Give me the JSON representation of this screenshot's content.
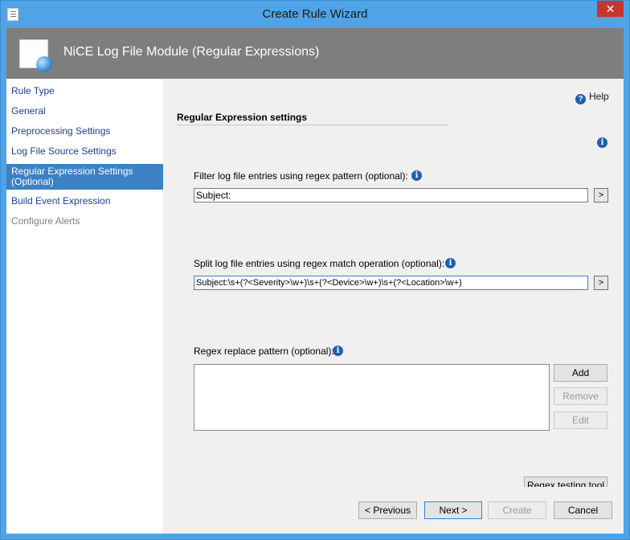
{
  "window": {
    "title": "Create Rule Wizard",
    "close_glyph": "✕"
  },
  "header": {
    "title": "NiCE Log File Module (Regular Expressions)"
  },
  "nav": {
    "items": [
      {
        "label": "Rule Type"
      },
      {
        "label": "General"
      },
      {
        "label": "Preprocessing Settings"
      },
      {
        "label": "Log File Source Settings"
      },
      {
        "label": "Regular Expression Settings (Optional)"
      },
      {
        "label": "Build Event Expression"
      },
      {
        "label": "Configure Alerts"
      }
    ],
    "selected": "Regular Expression Settings (Optional)",
    "disabled": "Configure Alerts"
  },
  "help": {
    "label": "Help",
    "q_glyph": "?",
    "info_glyph": "i"
  },
  "section": {
    "title": "Regular Expression settings"
  },
  "filter": {
    "label": "Filter log file entries using regex pattern (optional):",
    "value": "Subject:",
    "button": ">"
  },
  "split": {
    "label": "Split log file entries using regex match operation (optional):",
    "value": "Subject:\\s+(?<Severity>\\w+)\\s+(?<Device>\\w+)\\s+(?<Location>\\w+)",
    "button": ">"
  },
  "replace": {
    "label": "Regex replace pattern (optional):",
    "add_label": "Add",
    "remove_label": "Remove",
    "edit_label": "Edit"
  },
  "regex_tool": {
    "label": "Regex testing tool"
  },
  "footer": {
    "previous_label": "< Previous",
    "next_label": "Next >",
    "create_label": "Create",
    "cancel_label": "Cancel"
  },
  "colors": {
    "titlebar": "#4fa3e6",
    "header": "#7e7e7e",
    "nav_selected": "#3c81c4",
    "close": "#c8352c"
  }
}
